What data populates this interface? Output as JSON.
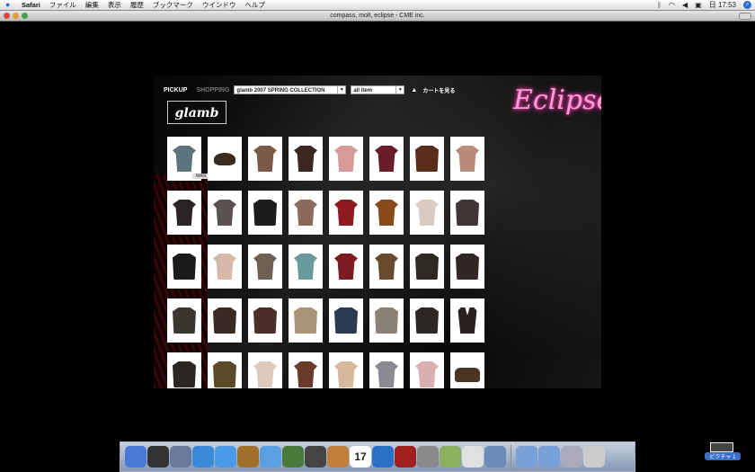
{
  "menubar": {
    "app": "Safari",
    "items": [
      "ファイル",
      "編集",
      "表示",
      "履歴",
      "ブックマーク",
      "ウインドウ",
      "ヘルプ"
    ],
    "clock": "日 17:53"
  },
  "window": {
    "title": "compass, molt, eclipse - CME inc."
  },
  "site": {
    "nav_pickup": "PICKUP",
    "nav_shopping": "SHOPPING",
    "collection_select": "glamb 2007 SPRING COLLECTION",
    "category_select": "all item",
    "cart_label": "カートを見る",
    "brand_logo": "glamb",
    "site_logo": "Eclipse",
    "hover_label": "MAN... T"
  },
  "products": [
    {
      "type": "shirt",
      "color": "#5d7480"
    },
    {
      "type": "hat",
      "color": "#3b2a1e"
    },
    {
      "type": "shirt",
      "color": "#7a5a48"
    },
    {
      "type": "shirt",
      "color": "#3b2620"
    },
    {
      "type": "shirt",
      "color": "#d79a9a"
    },
    {
      "type": "shirt",
      "color": "#6a1c2a"
    },
    {
      "type": "jacket",
      "color": "#5a2c1c"
    },
    {
      "type": "shirt",
      "color": "#b88a7a"
    },
    {
      "type": "shirt",
      "color": "#2a2426"
    },
    {
      "type": "shirt",
      "color": "#5a5250"
    },
    {
      "type": "jacket",
      "color": "#1e1c1e"
    },
    {
      "type": "shirt",
      "color": "#8a6a5a"
    },
    {
      "type": "shirt",
      "color": "#8c1a1e"
    },
    {
      "type": "shirt",
      "color": "#8a4a1c"
    },
    {
      "type": "shirt",
      "color": "#d8ccc2"
    },
    {
      "type": "jacket",
      "color": "#3e3634"
    },
    {
      "type": "jacket",
      "color": "#1c1a1c"
    },
    {
      "type": "shirt",
      "color": "#d8b8a8"
    },
    {
      "type": "shirt",
      "color": "#6e6052"
    },
    {
      "type": "shirt",
      "color": "#6a9a9c"
    },
    {
      "type": "shirt",
      "color": "#7a1c22"
    },
    {
      "type": "shirt",
      "color": "#6a4a2e"
    },
    {
      "type": "jacket",
      "color": "#2c2a22"
    },
    {
      "type": "jacket",
      "color": "#302624"
    },
    {
      "type": "jacket",
      "color": "#3c3630"
    },
    {
      "type": "jacket",
      "color": "#3a2a24"
    },
    {
      "type": "jacket",
      "color": "#4a3028"
    },
    {
      "type": "jacket",
      "color": "#a89478"
    },
    {
      "type": "jacket",
      "color": "#2c3a52"
    },
    {
      "type": "jacket",
      "color": "#8a8274"
    },
    {
      "type": "jacket",
      "color": "#2c2824"
    },
    {
      "type": "vest",
      "color": "#2a2220"
    },
    {
      "type": "jacket",
      "color": "#2a2624"
    },
    {
      "type": "jacket",
      "color": "#5a4a2a"
    },
    {
      "type": "shirt",
      "color": "#dccabc"
    },
    {
      "type": "shirt",
      "color": "#6a3a2a"
    },
    {
      "type": "shirt",
      "color": "#d8b89c"
    },
    {
      "type": "shirt",
      "color": "#8a8a92"
    },
    {
      "type": "shirt",
      "color": "#d8b0b0"
    },
    {
      "type": "bag",
      "color": "#4a3424"
    }
  ],
  "dock": {
    "apps": [
      {
        "icon": "finder-icon",
        "color": "#4a7ad8"
      },
      {
        "icon": "dashboard-icon",
        "color": "#333"
      },
      {
        "icon": "system-prefs-icon",
        "color": "#6a7a9a"
      },
      {
        "icon": "safari-icon",
        "color": "#3a8ad8"
      },
      {
        "icon": "ichat-icon",
        "color": "#4a9ae8"
      },
      {
        "icon": "address-book-icon",
        "color": "#a0702a"
      },
      {
        "icon": "itunes-icon",
        "color": "#5aa0e0"
      },
      {
        "icon": "iphoto-icon",
        "color": "#4a7a3a"
      },
      {
        "icon": "dvd-player-icon",
        "color": "#444"
      },
      {
        "icon": "garageband-icon",
        "color": "#c0803a"
      },
      {
        "icon": "ical-icon",
        "color": "#fff"
      },
      {
        "icon": "sync-icon",
        "color": "#2a70c8"
      },
      {
        "icon": "front-row-icon",
        "color": "#a02020"
      },
      {
        "icon": "system-icon",
        "color": "#8a8a8a"
      },
      {
        "icon": "script-editor-icon",
        "color": "#8ab060"
      },
      {
        "icon": "preview-icon",
        "color": "#e0e0e0"
      },
      {
        "icon": "photo-icon",
        "color": "#6a8ab8"
      }
    ],
    "ical_day": "17",
    "folders": [
      {
        "icon": "applications-folder-icon",
        "color": "#7aa0d8"
      },
      {
        "icon": "documents-folder-icon",
        "color": "#7aa0d8"
      },
      {
        "icon": "mail-icon",
        "color": "#aab"
      },
      {
        "icon": "trash-icon",
        "color": "#ccc"
      }
    ]
  },
  "desktop": {
    "picture_label": "ピクチャ 1"
  }
}
